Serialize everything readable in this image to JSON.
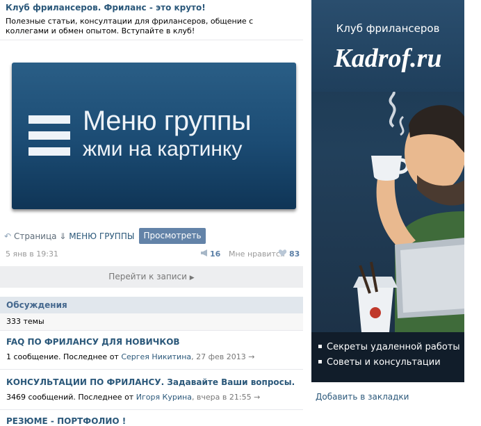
{
  "post": {
    "title": "Клуб фрилансеров. Фриланс - это круто!",
    "description": "Полезные статьи, консултации для фрилансеров, общение с коллегами и обмен опытом. Вступайте в клуб!",
    "menu_banner": {
      "line1": "Меню группы",
      "line2": "жми на картинку"
    },
    "attachment": {
      "prefix": "Страница ⇓ ",
      "link": "МЕНЮ ГРУППЫ",
      "suffix": " ⇓",
      "button": "Просмотреть"
    },
    "date": "5 янв в 19:31",
    "shares": "16",
    "like_label": "Мне нравится",
    "likes": "83"
  },
  "goto_label": "Перейти к записи",
  "discussions": {
    "header": "Обсуждения",
    "count": "333 темы",
    "topics": [
      {
        "title": "FAQ ПО ФРИЛАНСУ ДЛЯ НОВИЧКОВ",
        "count": "1 сообщение. Последнее от ",
        "author": "Сергея Никитина",
        "date": ", 27 фев 2013",
        "arrow": "→"
      },
      {
        "title": "КОНСУЛЬТАЦИИ ПО ФРИЛАНСУ. Задавайте Ваши вопросы.",
        "count": "3469 сообщений. Последнее от ",
        "author": "Игоря Курина",
        "date": ", вчера в 21:55",
        "arrow": "→"
      },
      {
        "title": "РЕЗЮМЕ - ПОРТФОЛИО !"
      }
    ]
  },
  "ad": {
    "club": "Клуб фрилансеров",
    "site": "Kadrof.ru",
    "bullets": [
      "Секреты удаленной работы",
      "Советы и консультации"
    ]
  },
  "bookmark_label": "Добавить в закладки",
  "icons": {
    "attach": "arrow-icon",
    "share": "megaphone-icon",
    "like": "heart-icon",
    "goto": "chevron-right-icon"
  }
}
